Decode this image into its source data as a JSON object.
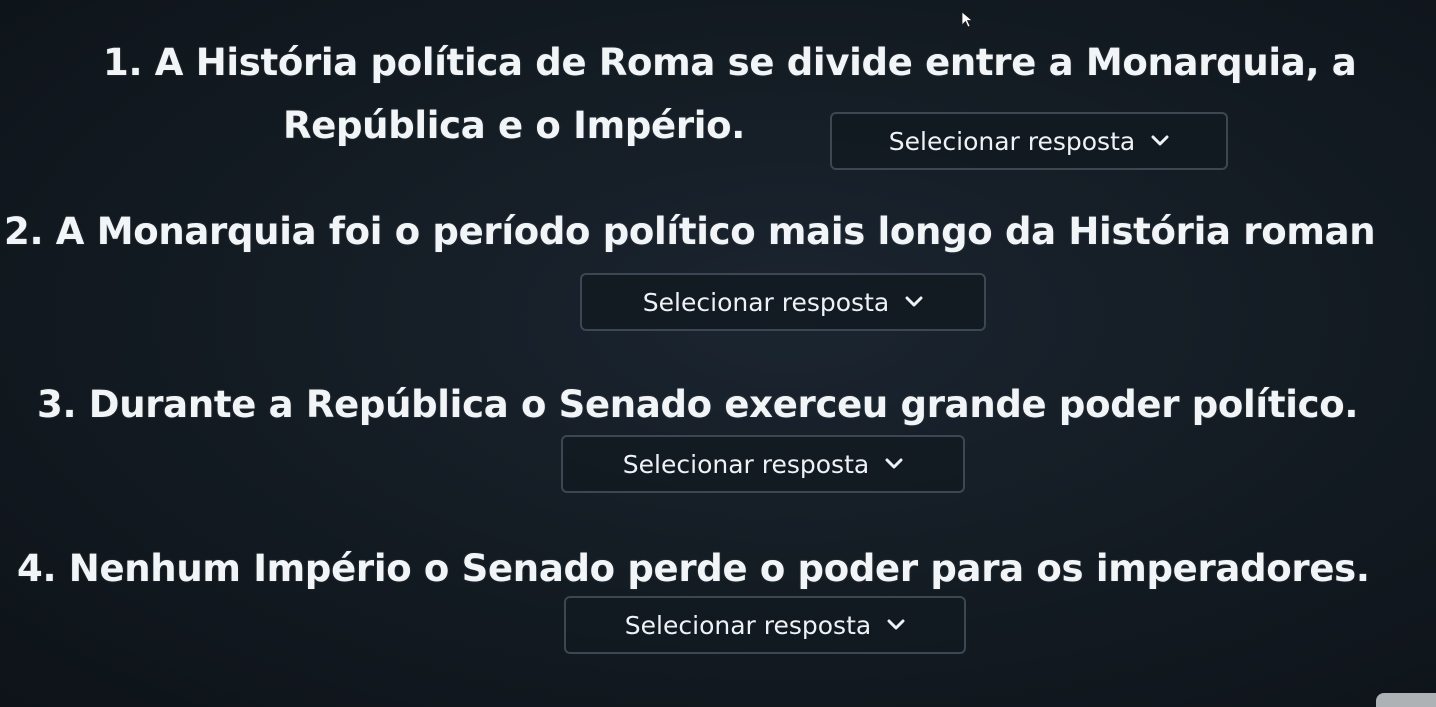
{
  "questions": [
    {
      "line1": "1. A História política de Roma se divide entre a Monarquia, a",
      "line2": "República e o Império.",
      "select_label": "Selecionar resposta"
    },
    {
      "line1": "2. A Monarquia foi o período político mais longo da História roman",
      "select_label": "Selecionar resposta"
    },
    {
      "line1": "3. Durante a República o Senado exerceu grande poder político.",
      "select_label": "Selecionar resposta"
    },
    {
      "line1": "4. Nenhum Império o Senado perde o poder para os imperadores.",
      "select_label": "Selecionar resposta"
    }
  ],
  "icons": {
    "dropdown": "chevron-down-icon",
    "pointer": "mouse-cursor-icon"
  },
  "colors": {
    "background": "#141c24",
    "text": "#f2f5f7",
    "select_border": "#3b4752"
  }
}
